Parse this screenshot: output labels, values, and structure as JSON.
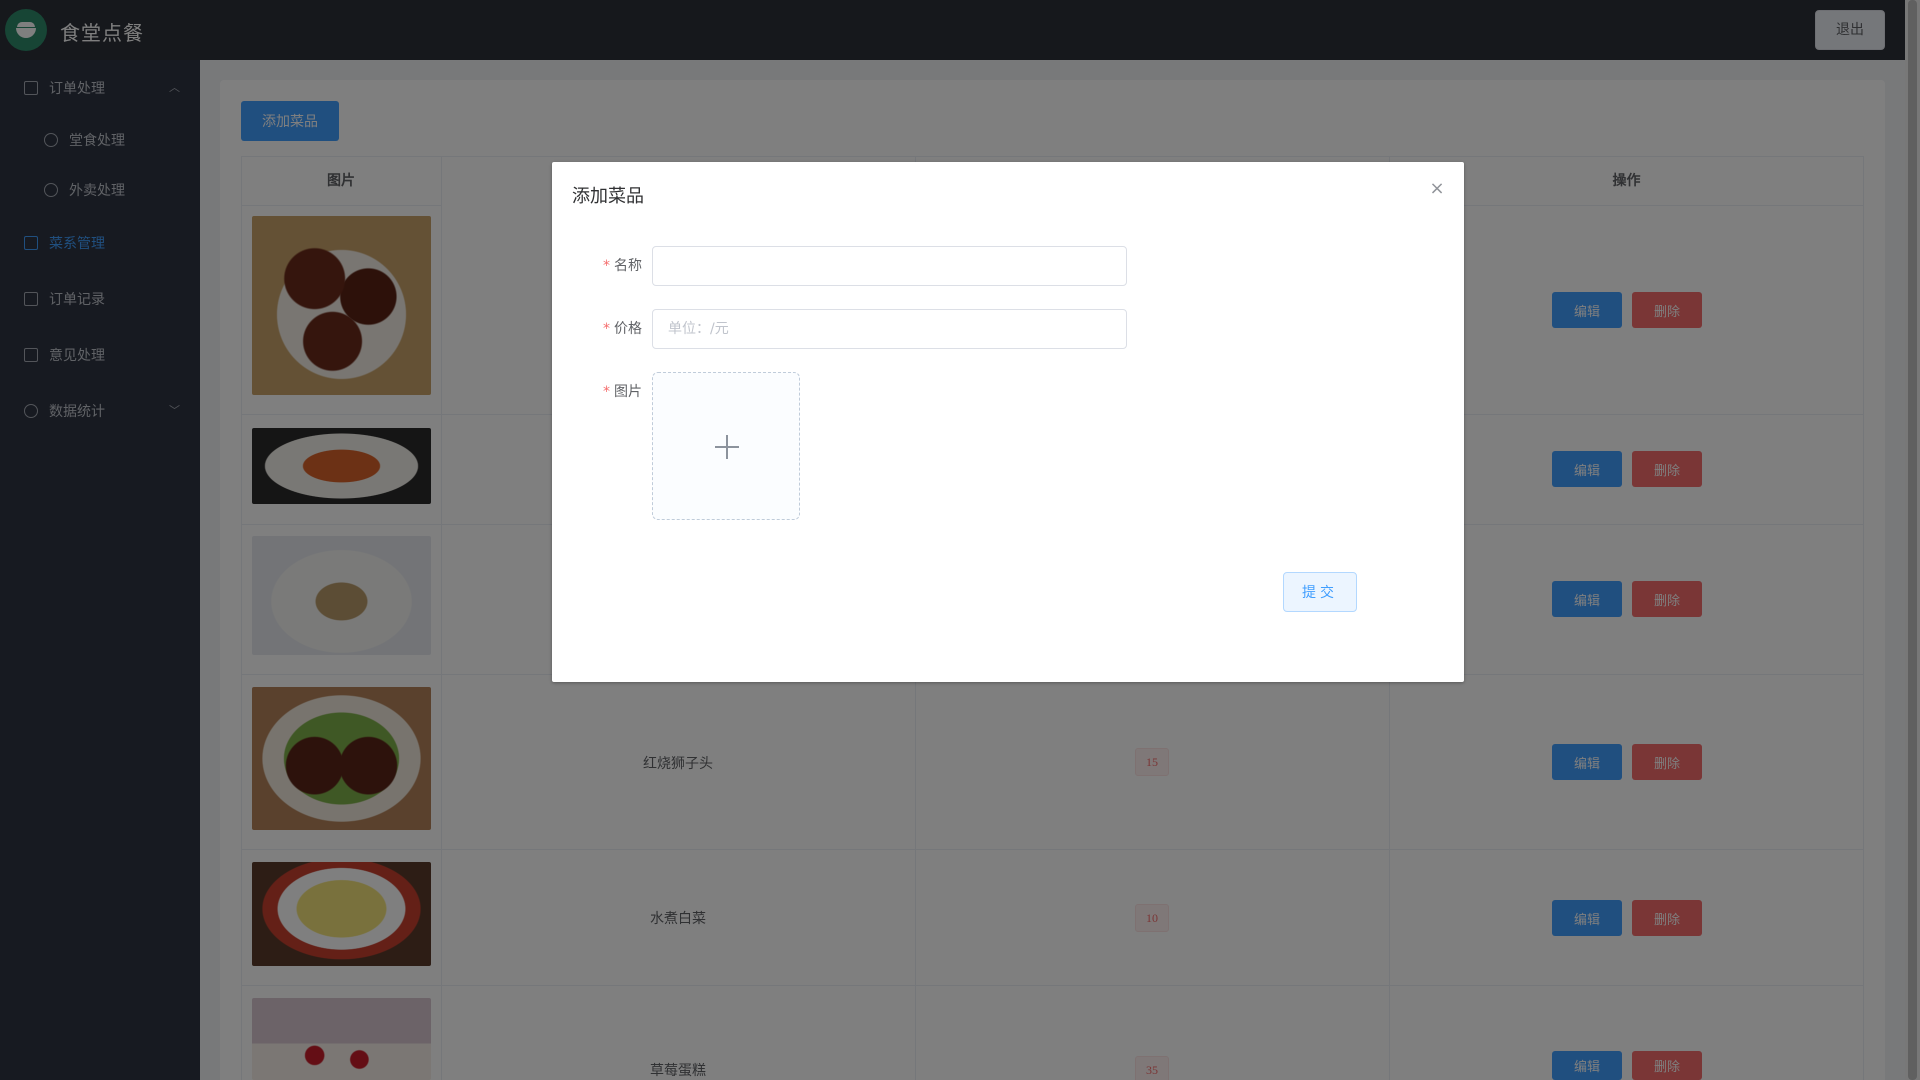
{
  "app": {
    "brand": "食堂点餐",
    "logout_label": "退出"
  },
  "sidebar": {
    "items": [
      {
        "label": "订单处理",
        "arrow": "︿"
      },
      {
        "label": "堂食处理"
      },
      {
        "label": "外卖处理"
      },
      {
        "label": "菜系管理"
      },
      {
        "label": "订单记录"
      },
      {
        "label": "意见处理"
      },
      {
        "label": "数据统计",
        "arrow": "﹀"
      }
    ]
  },
  "main": {
    "add_button_label": "添加菜品",
    "columns": {
      "image": "图片",
      "actions": "操作"
    },
    "rows": [
      {
        "name": "红烧狮子头",
        "price": "15"
      },
      {
        "name": "水煮白菜",
        "price": "10"
      },
      {
        "name": "草莓蛋糕",
        "price": "35"
      }
    ],
    "edit_label": "编辑",
    "delete_label": "删除"
  },
  "dialog": {
    "title": "添加菜品",
    "close_icon": "×",
    "fields": {
      "name_label": "名称",
      "price_label": "价格",
      "price_placeholder": "单位：/元",
      "image_label": "图片"
    },
    "required_mark": "*",
    "submit_label": "提交"
  },
  "colors": {
    "accent": "#409eff",
    "danger": "#f56c6c",
    "header": "#2c3038",
    "sidebar": "#2f3542"
  }
}
